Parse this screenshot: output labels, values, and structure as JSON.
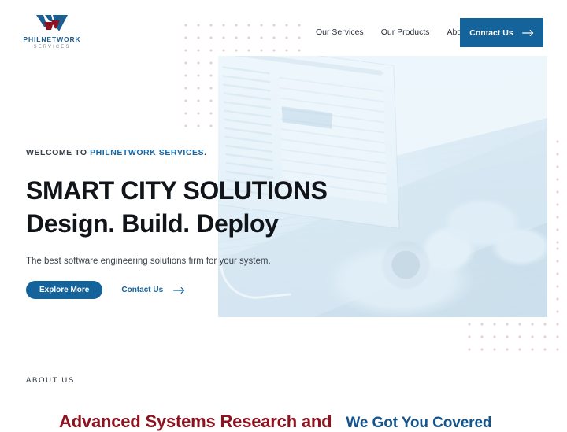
{
  "brand": {
    "name": "PHILNETWORK",
    "sub": "SERVICES",
    "logo_icon": "w-monogram-logo",
    "colors": {
      "blue": "#1b5e92",
      "red": "#8e1320"
    }
  },
  "nav": {
    "items": [
      {
        "label": "Our Services"
      },
      {
        "label": "Our Products"
      },
      {
        "label": "About"
      }
    ],
    "cta": {
      "label": "Contact Us",
      "icon": "arrow-right-icon",
      "bg": "#14639b"
    }
  },
  "hero": {
    "eyebrow_prefix": "WELCOME TO ",
    "eyebrow_highlight": "PHILNETWORK SERVICES",
    "eyebrow_suffix": ".",
    "headline_line1": "SMART CITY SOLUTIONS",
    "headline_line2": "Design. Build. Deploy",
    "subcopy": "The best software engineering solutions firm for your system.",
    "primary_cta": {
      "label": "Explore More"
    },
    "secondary_cta": {
      "label": "Contact Us",
      "icon": "arrow-right-icon"
    },
    "media": {
      "alt": "hands typing on laptop with smartwatch",
      "tint": "#dbecf7"
    }
  },
  "about": {
    "kicker": "ABOUT US",
    "heading_red": "Advanced Systems Research and",
    "heading_blue": "We Got You Covered"
  },
  "decor": {
    "dot_color": "#e9cfcf",
    "patterns": [
      "dots-top-left",
      "dots-right-column",
      "dots-right-strip"
    ]
  }
}
